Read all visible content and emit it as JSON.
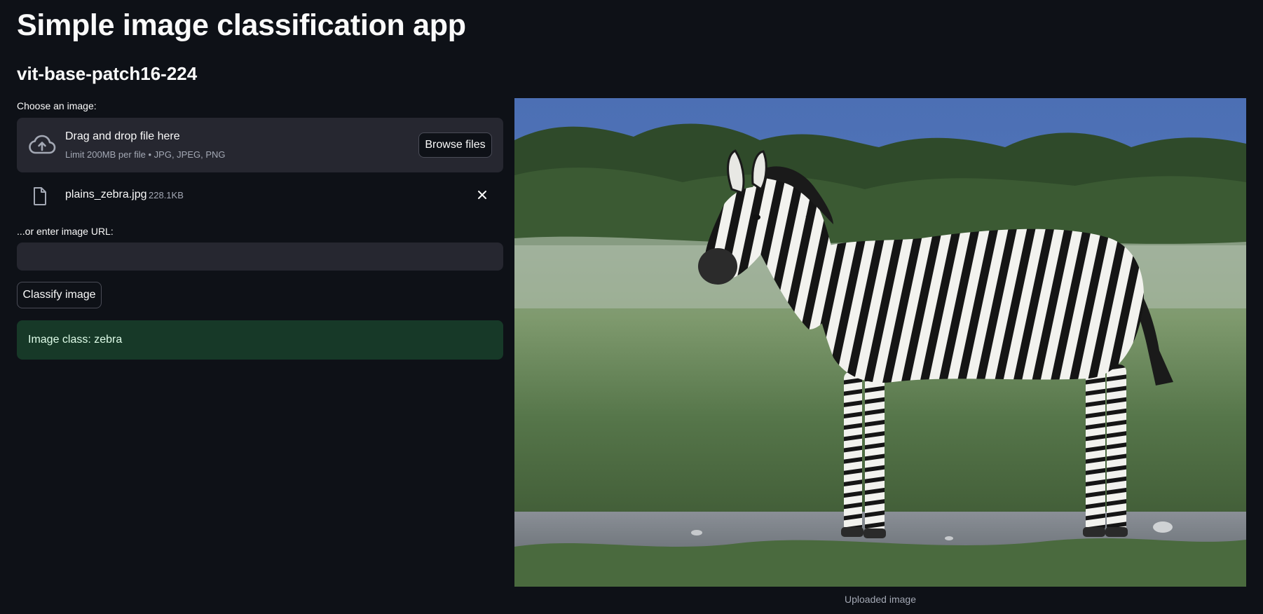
{
  "header": {
    "title": "Simple image classification app",
    "model_name": "vit-base-patch16-224"
  },
  "uploader": {
    "label": "Choose an image:",
    "drop_title": "Drag and drop file here",
    "drop_limit": "Limit 200MB per file • JPG, JPEG, PNG",
    "browse_label": "Browse files",
    "cloud_icon": "cloud-upload-icon",
    "file_icon": "file-icon",
    "remove_icon": "close-icon",
    "file": {
      "name": "plains_zebra.jpg",
      "size": "228.1KB"
    }
  },
  "url_input": {
    "label": "...or enter image URL:",
    "value": "",
    "placeholder": ""
  },
  "actions": {
    "classify_label": "Classify image"
  },
  "result": {
    "message": "Image class: zebra",
    "color": "#173928"
  },
  "preview": {
    "caption": "Uploaded image"
  },
  "colors": {
    "background": "#0e1117",
    "widget": "#262730",
    "text": "#fafafa"
  }
}
